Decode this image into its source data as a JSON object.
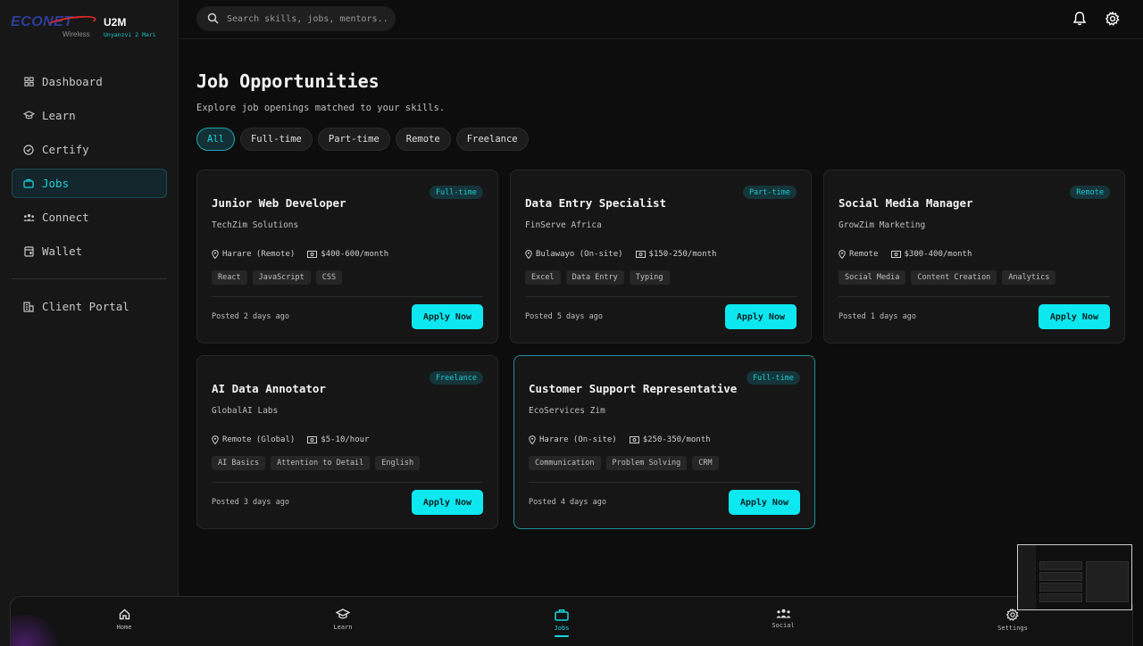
{
  "brand": {
    "logo": "ECONET",
    "sub": "Wireless",
    "app": "U2M",
    "tagline": "Unyanzvi 2 Mari"
  },
  "search": {
    "placeholder": "Search skills, jobs, mentors..."
  },
  "sidebar": {
    "items": [
      {
        "label": "Dashboard",
        "icon": "grid-icon"
      },
      {
        "label": "Learn",
        "icon": "graduation-cap-icon"
      },
      {
        "label": "Certify",
        "icon": "badge-check-icon"
      },
      {
        "label": "Jobs",
        "icon": "briefcase-icon",
        "active": true
      },
      {
        "label": "Connect",
        "icon": "users-icon"
      },
      {
        "label": "Wallet",
        "icon": "wallet-icon"
      }
    ],
    "secondary": [
      {
        "label": "Client Portal",
        "icon": "building-icon"
      }
    ]
  },
  "page": {
    "title": "Job Opportunities",
    "subtitle": "Explore job openings matched to your skills."
  },
  "filters": [
    "All",
    "Full-time",
    "Part-time",
    "Remote",
    "Freelance"
  ],
  "active_filter": "All",
  "jobs": [
    {
      "title": "Junior Web Developer",
      "company": "TechZim Solutions",
      "type": "Full-time",
      "location": "Harare (Remote)",
      "pay": "$400-600/month",
      "tags": [
        "React",
        "JavaScript",
        "CSS"
      ],
      "posted": "Posted 2 days ago",
      "cta": "Apply Now"
    },
    {
      "title": "Data Entry Specialist",
      "company": "FinServe Africa",
      "type": "Part-time",
      "location": "Bulawayo (On-site)",
      "pay": "$150-250/month",
      "tags": [
        "Excel",
        "Data Entry",
        "Typing"
      ],
      "posted": "Posted 5 days ago",
      "cta": "Apply Now"
    },
    {
      "title": "Social Media Manager",
      "company": "GrowZim Marketing",
      "type": "Remote",
      "location": "Remote",
      "pay": "$300-400/month",
      "tags": [
        "Social Media",
        "Content Creation",
        "Analytics"
      ],
      "posted": "Posted 1 days ago",
      "cta": "Apply Now"
    },
    {
      "title": "AI Data Annotator",
      "company": "GlobalAI Labs",
      "type": "Freelance",
      "location": "Remote (Global)",
      "pay": "$5-10/hour",
      "tags": [
        "AI Basics",
        "Attention to Detail",
        "English"
      ],
      "posted": "Posted 3 days ago",
      "cta": "Apply Now"
    },
    {
      "title": "Customer Support Representative",
      "company": "EcoServices Zim",
      "type": "Full-time",
      "location": "Harare (On-site)",
      "pay": "$250-350/month",
      "tags": [
        "Communication",
        "Problem Solving",
        "CRM"
      ],
      "posted": "Posted 4 days ago",
      "cta": "Apply Now",
      "focused": true
    }
  ],
  "bottom_nav": [
    {
      "label": "Home",
      "icon": "home-icon"
    },
    {
      "label": "Learn",
      "icon": "graduation-cap-icon"
    },
    {
      "label": "Jobs",
      "icon": "briefcase-icon",
      "active": true
    },
    {
      "label": "Social",
      "icon": "users-icon"
    },
    {
      "label": "Settings",
      "icon": "gear-icon"
    }
  ],
  "colors": {
    "accent": "#0de8f0",
    "background": "#0d0d0d",
    "panel": "#171717",
    "brand_blue": "#2c3e9a",
    "brand_red": "#d62828"
  }
}
